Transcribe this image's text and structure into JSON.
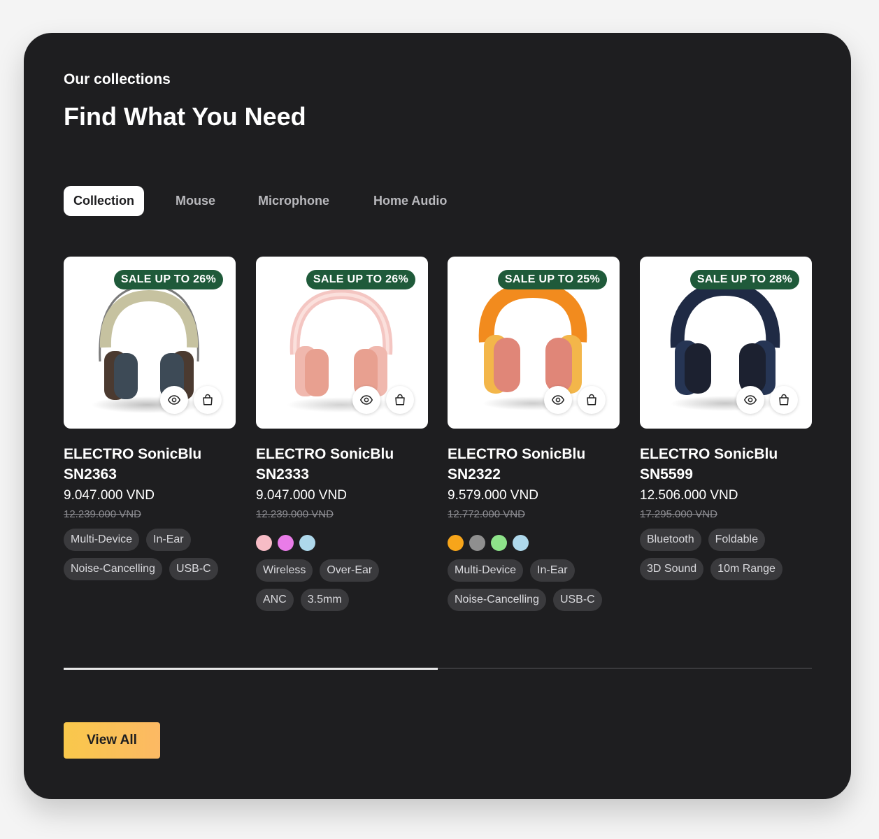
{
  "header": {
    "eyebrow": "Our collections",
    "title": "Find What You Need"
  },
  "tabs": [
    {
      "label": "Collection",
      "active": true
    },
    {
      "label": "Mouse",
      "active": false
    },
    {
      "label": "Microphone",
      "active": false
    },
    {
      "label": "Home Audio",
      "active": false
    }
  ],
  "products": [
    {
      "sale": "SALE UP TO 26%",
      "name": "ELECTRO SonicBlu SN2363",
      "price": "9.047.000 VND",
      "old_price": "12.239.000 VND",
      "image_icon": "headphones-vintage-icon",
      "colors": [],
      "tags": [
        "Multi-Device",
        "In-Ear",
        "Noise-Cancelling",
        "USB-C"
      ]
    },
    {
      "sale": "SALE UP TO 26%",
      "name": "ELECTRO SonicBlu SN2333",
      "price": "9.047.000 VND",
      "old_price": "12.239.000 VND",
      "image_icon": "headphones-pink-icon",
      "colors": [
        "#f7bcc6",
        "#e97ce8",
        "#aed8eb"
      ],
      "tags": [
        "Wireless",
        "Over-Ear",
        "ANC",
        "3.5mm"
      ]
    },
    {
      "sale": "SALE UP TO 25%",
      "name": "ELECTRO SonicBlu SN2322",
      "price": "9.579.000 VND",
      "old_price": "12.772.000 VND",
      "image_icon": "headphones-orange-icon",
      "colors": [
        "#f7a51a",
        "#8f8f8f",
        "#8ee38a",
        "#aed8eb"
      ],
      "tags": [
        "Multi-Device",
        "In-Ear",
        "Noise-Cancelling",
        "USB-C"
      ]
    },
    {
      "sale": "SALE UP TO 28%",
      "name": "ELECTRO SonicBlu SN5599",
      "price": "12.506.000 VND",
      "old_price": "17.295.000 VND",
      "image_icon": "headphones-navy-icon",
      "colors": [],
      "tags": [
        "Bluetooth",
        "Foldable",
        "3D Sound",
        "10m Range"
      ]
    }
  ],
  "scroll_progress": 0.5,
  "view_all_label": "View All",
  "colors": {
    "panel": "#1e1e20",
    "sale_badge": "#1f5a3a",
    "accent": "#f9c84b"
  }
}
